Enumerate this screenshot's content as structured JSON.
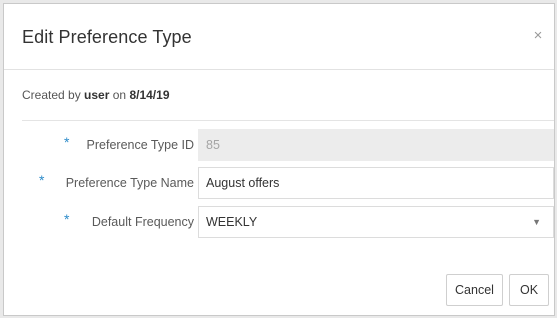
{
  "dialog": {
    "title": "Edit Preference Type",
    "close_glyph": "×"
  },
  "created": {
    "prefix": "Created by",
    "user": "user",
    "on": "on",
    "date": "8/14/19"
  },
  "form": {
    "fields": [
      {
        "label": "Preference Type ID",
        "value": "85",
        "required": "*",
        "state": "read-only"
      },
      {
        "label": "Preference Type Name",
        "value": "August offers",
        "required": "*",
        "state": "editable"
      },
      {
        "label": "Default Frequency",
        "value": "WEEKLY",
        "required": "*",
        "state": "dropdown"
      }
    ],
    "dropdown_caret": "▼"
  },
  "buttons": {
    "cancel": "Cancel",
    "ok": "OK"
  },
  "colors": {
    "required_marker": "#2d8bc9",
    "readonly_bg": "#ececec"
  },
  "icons": {
    "close": "close-icon",
    "dropdown": "chevron-down-icon"
  }
}
